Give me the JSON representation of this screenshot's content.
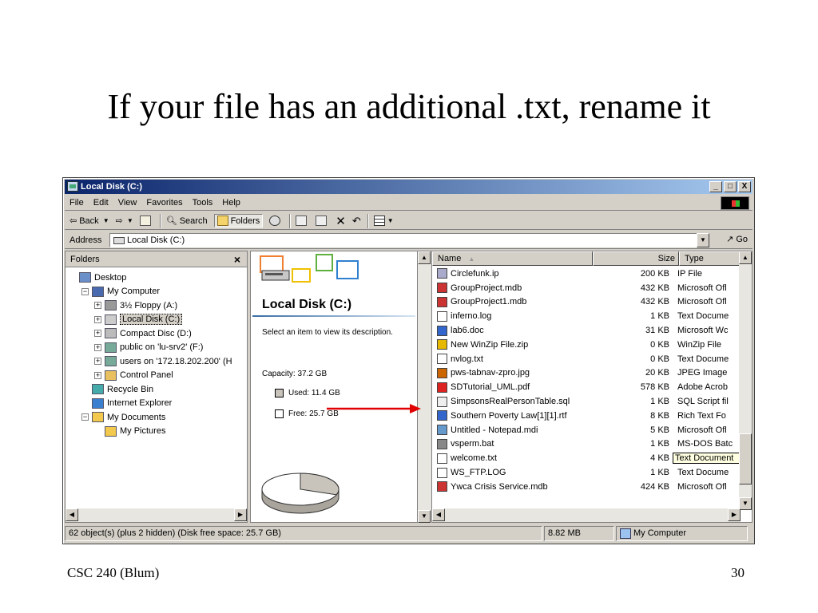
{
  "slide": {
    "title": "If your file has an additional .txt, rename it",
    "footer_left": "CSC 240 (Blum)",
    "page_number": "30"
  },
  "window": {
    "title": "Local Disk (C:)",
    "controls": [
      "_",
      "□",
      "X"
    ]
  },
  "menu": [
    "File",
    "Edit",
    "View",
    "Favorites",
    "Tools",
    "Help"
  ],
  "toolbar": {
    "back": "Back",
    "search": "Search",
    "folders": "Folders"
  },
  "address": {
    "label": "Address",
    "value": "Local Disk (C:)",
    "go": "Go"
  },
  "folders_pane": {
    "header": "Folders",
    "close": "×",
    "tree": [
      {
        "label": "Desktop",
        "indent": 0,
        "toggle": ""
      },
      {
        "label": "My Computer",
        "indent": 1,
        "toggle": "−"
      },
      {
        "label": "3½ Floppy (A:)",
        "indent": 2,
        "toggle": "+"
      },
      {
        "label": "Local Disk (C:)",
        "indent": 2,
        "toggle": "+",
        "selected": true
      },
      {
        "label": "Compact Disc (D:)",
        "indent": 2,
        "toggle": "+"
      },
      {
        "label": "public on 'lu-srv2' (F:)",
        "indent": 2,
        "toggle": "+"
      },
      {
        "label": "users on '172.18.202.200' (H",
        "indent": 2,
        "toggle": "+"
      },
      {
        "label": "Control Panel",
        "indent": 2,
        "toggle": "+"
      },
      {
        "label": "Recycle Bin",
        "indent": 1,
        "toggle": ""
      },
      {
        "label": "Internet Explorer",
        "indent": 1,
        "toggle": ""
      },
      {
        "label": "My Documents",
        "indent": 1,
        "toggle": "−"
      },
      {
        "label": "My Pictures",
        "indent": 2,
        "toggle": ""
      }
    ]
  },
  "info_pane": {
    "title": "Local Disk (C:)",
    "description": "Select an item to view its description.",
    "capacity": "Capacity: 37.2 GB",
    "used": "Used: 11.4 GB",
    "free": "Free: 25.7 GB",
    "used_fraction": 0.306,
    "used_color": "#c8c4bc",
    "free_color": "#ffffff"
  },
  "file_list": {
    "columns": {
      "name": "Name",
      "sort_indicator": "▲",
      "size": "Size",
      "type": "Type"
    },
    "files": [
      {
        "name": "Circlefunk.ip",
        "size": "200 KB",
        "type": "IP File",
        "icon": "ip-file-icon"
      },
      {
        "name": "GroupProject.mdb",
        "size": "432 KB",
        "type": "Microsoft Ofl",
        "icon": "access-db-icon"
      },
      {
        "name": "GroupProject1.mdb",
        "size": "432 KB",
        "type": "Microsoft Ofl",
        "icon": "access-db-icon"
      },
      {
        "name": "inferno.log",
        "size": "1 KB",
        "type": "Text Docume",
        "icon": "text-file-icon"
      },
      {
        "name": "lab6.doc",
        "size": "31 KB",
        "type": "Microsoft Wc",
        "icon": "word-doc-icon"
      },
      {
        "name": "New WinZip File.zip",
        "size": "0 KB",
        "type": "WinZip File",
        "icon": "zip-file-icon"
      },
      {
        "name": "nvlog.txt",
        "size": "0 KB",
        "type": "Text Docume",
        "icon": "text-file-icon"
      },
      {
        "name": "pws-tabnav-zpro.jpg",
        "size": "20 KB",
        "type": "JPEG Image",
        "icon": "jpeg-image-icon"
      },
      {
        "name": "SDTutorial_UML.pdf",
        "size": "578 KB",
        "type": "Adobe Acrob",
        "icon": "pdf-file-icon"
      },
      {
        "name": "SimpsonsRealPersonTable.sql",
        "size": "1 KB",
        "type": "SQL Script fil",
        "icon": "sql-file-icon"
      },
      {
        "name": "Southern Poverty Law[1][1].rtf",
        "size": "8 KB",
        "type": "Rich Text Fo",
        "icon": "rtf-file-icon"
      },
      {
        "name": "Untitled - Notepad.mdi",
        "size": "5 KB",
        "type": "Microsoft Ofl",
        "icon": "mdi-file-icon"
      },
      {
        "name": "vsperm.bat",
        "size": "1 KB",
        "type": "MS-DOS Batc",
        "icon": "batch-file-icon"
      },
      {
        "name": "welcome.txt",
        "size": "4 KB",
        "type": "Text Document",
        "icon": "text-file-icon",
        "highlight": true
      },
      {
        "name": "WS_FTP.LOG",
        "size": "1 KB",
        "type": "Text Docume",
        "icon": "text-file-icon"
      },
      {
        "name": "Ywca Crisis  Service.mdb",
        "size": "424 KB",
        "type": "Microsoft Ofl",
        "icon": "access-db-icon"
      }
    ]
  },
  "status": {
    "objects": "62 object(s) (plus 2 hidden) (Disk free space: 25.7 GB)",
    "size": "8.82 MB",
    "zone": "My Computer"
  },
  "colors": {
    "title_bar": "#0a246a",
    "window_face": "#d4d0c8",
    "arrow": "#e00000"
  }
}
